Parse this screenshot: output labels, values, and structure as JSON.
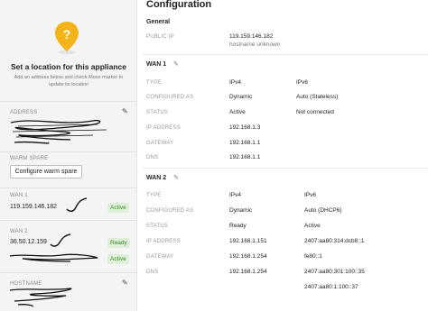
{
  "sidebar": {
    "location_title": "Set a location for this appliance",
    "location_subtitle": "Add an address below and check Move marker to update its location",
    "address_label": "ADDRESS",
    "warm_spare_label": "WARM SPARE",
    "warm_spare_button": "Configure warm spare",
    "wan1_label": "WAN 1",
    "wan1_ip": "119.159.146.182",
    "wan1_status": "Active",
    "wan2_label": "WAN 2",
    "wan2_ip": "36.50.12.159",
    "wan2_status_1": "Ready",
    "wan2_status_2": "Active",
    "hostname_label": "HOSTNAME"
  },
  "config": {
    "title": "Configuration",
    "general": {
      "heading": "General",
      "public_ip_label": "PUBLIC IP",
      "public_ip": "119.159.146.182",
      "hostname": "hostname unknown"
    },
    "wan1": {
      "heading": "WAN 1",
      "rows": [
        {
          "label": "TYPE",
          "ipv4": "IPv4",
          "ipv6": "IPv6"
        },
        {
          "label": "CONFIGURED AS",
          "ipv4": "Dynamic",
          "ipv6": "Auto (Stateless)"
        },
        {
          "label": "STATUS",
          "ipv4": "Active",
          "ipv6": "Not connected"
        },
        {
          "label": "IP ADDRESS",
          "ipv4": "192.168.1.3",
          "ipv6": ""
        },
        {
          "label": "GATEWAY",
          "ipv4": "192.168.1.1",
          "ipv6": ""
        },
        {
          "label": "DNS",
          "ipv4": "192.168.1.1",
          "ipv6": ""
        }
      ]
    },
    "wan2": {
      "heading": "WAN 2",
      "rows": [
        {
          "label": "TYPE",
          "ipv4": "IPv4",
          "ipv6": "IPv6"
        },
        {
          "label": "CONFIGURED AS",
          "ipv4": "Dynamic",
          "ipv6": "Auto (DHCP6)"
        },
        {
          "label": "STATUS",
          "ipv4": "Ready",
          "ipv6": "Active"
        },
        {
          "label": "IP ADDRESS",
          "ipv4": "192.168.1.151",
          "ipv6": "2407:aa80:314:dcb8::1"
        },
        {
          "label": "GATEWAY",
          "ipv4": "192.168.1.254",
          "ipv6": "fe80::1"
        },
        {
          "label": "DNS",
          "ipv4": "192.168.1.254",
          "ipv6": "2407:aa80:301:100::35"
        },
        {
          "label": "",
          "ipv4": "",
          "ipv6": "2407:aa80:1:100::37"
        }
      ]
    }
  },
  "colors": {
    "accent_yellow": "#f2b418",
    "active_badge_bg": "#dff0d8",
    "active_badge_text": "#3c8a2e"
  },
  "icons": [
    "map-pin-question-icon",
    "pencil-icon"
  ]
}
